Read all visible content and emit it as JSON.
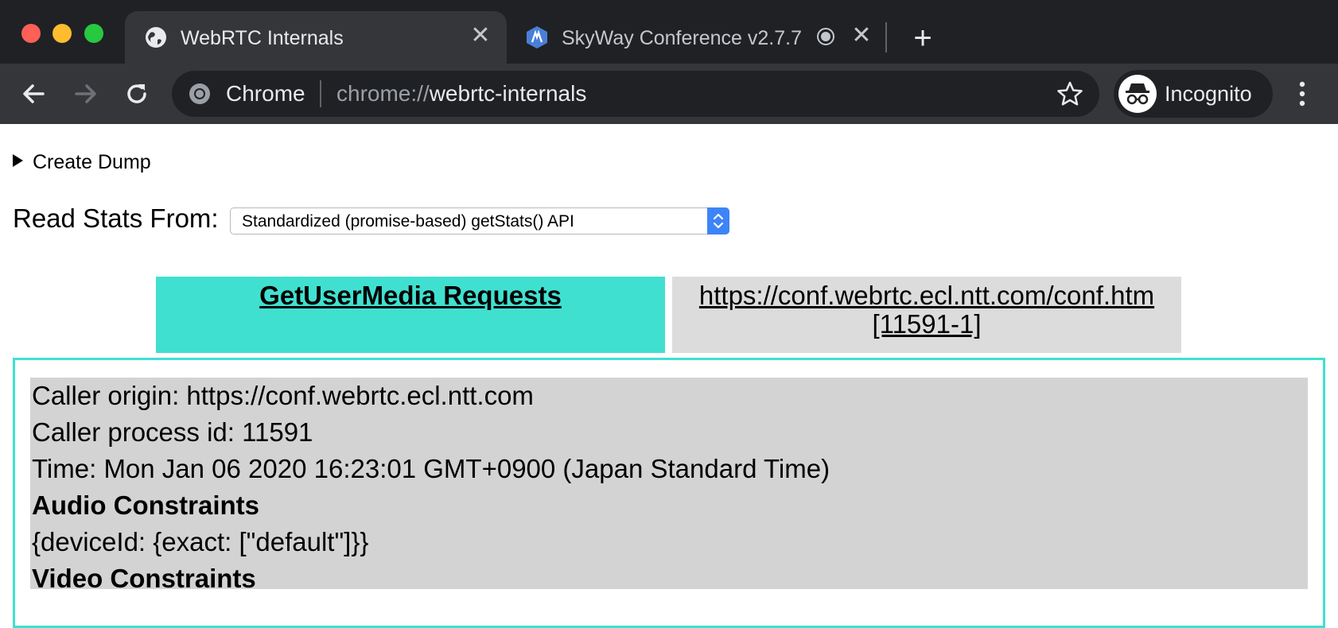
{
  "browser": {
    "tabs": [
      {
        "label": "WebRTC Internals",
        "active": true,
        "favicon": "globe-icon"
      },
      {
        "label": "SkyWay Conference v2.7.7",
        "active": false,
        "favicon": "skyway-icon",
        "recording": true
      }
    ],
    "omnibox": {
      "site_label": "Chrome",
      "url_scheme": "chrome://",
      "url_host": "webrtc-internals"
    },
    "incognito_label": "Incognito"
  },
  "page": {
    "create_dump": "Create Dump",
    "read_stats_label": "Read Stats From:",
    "read_stats_select": "Standardized (promise-based) getStats() API",
    "tabs": [
      {
        "label": "GetUserMedia Requests",
        "selected": true
      },
      {
        "label": "https://conf.webrtc.ecl.ntt.com/conf.htm",
        "label2": "[11591-1]",
        "selected": false
      }
    ],
    "request": {
      "origin": "Caller origin: https://conf.webrtc.ecl.ntt.com",
      "pid": "Caller process id: 11591",
      "time": "Time: Mon Jan 06 2020 16:23:01 GMT+0900 (Japan Standard Time)",
      "audio_heading": "Audio Constraints",
      "audio_value": "{deviceId: {exact: [\"default\"]}}",
      "video_heading": "Video Constraints"
    }
  },
  "colors": {
    "selected_tab": "#40e0d0",
    "unselected_tab": "#dcdcdc",
    "info_bg": "#d3d3d3"
  }
}
